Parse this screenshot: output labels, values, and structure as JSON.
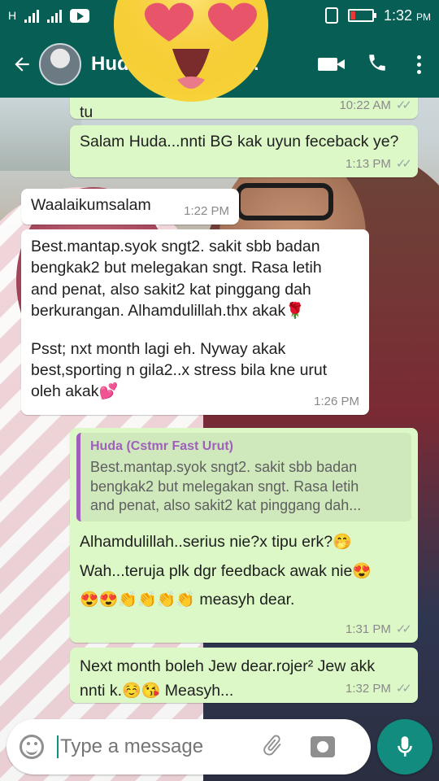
{
  "status_bar": {
    "carrier1": "H",
    "time": "1:32",
    "time_suffix": "PM"
  },
  "header": {
    "contact_name": "Hud",
    "contact_name_tail": "..."
  },
  "messages": [
    {
      "dir": "out",
      "text": "tu",
      "time": "10:22 AM"
    },
    {
      "dir": "out",
      "text": "Salam Huda...nnti BG kak uyun feceback ye?",
      "time": "1:13 PM"
    },
    {
      "dir": "in",
      "text": "Waalaikumsalam",
      "time": "1:22 PM"
    },
    {
      "dir": "in",
      "text_lines": [
        "Best.mantap.syok sngt2. sakit sbb badan",
        "bengkak2 but melegakan sngt. Rasa letih",
        "and penat, also sakit2 kat pinggang dah",
        "berkurangan. Alhamdulillah.thx akak"
      ],
      "emoji1": "🌹",
      "text2_lines": [
        "Psst; nxt month lagi eh. Nyway akak",
        "best,sporting n gila2..x stress bila kne urut",
        "oleh akak"
      ],
      "emoji2": "💕",
      "time": "1:26 PM"
    },
    {
      "dir": "out",
      "quote_name": "Huda (Cstmr Fast Urut)",
      "quote_lines": [
        "Best.mantap.syok sngt2. sakit sbb badan",
        "bengkak2 but melegakan sngt. Rasa letih",
        "and penat, also sakit2 kat pinggang dah..."
      ],
      "line1": "Alhamdulillah..serius nie?x tipu erk?",
      "line1_emoji": "🤭",
      "line2": "Wah...teruja plk dgr feedback awak nie",
      "line2_emoji": "😍",
      "line3_emoji": "😍😍👏👏👏👏",
      "line3": " measyh dear.",
      "time": "1:31 PM"
    },
    {
      "dir": "out",
      "line1": "Next month boleh Jew dear.rojer² Jew akk",
      "line2a": "nnti k.",
      "line2_emoji": "☺️😘",
      "line2b": " Measyh...",
      "time": "1:32 PM"
    }
  ],
  "input": {
    "placeholder": "Type a message"
  },
  "icons": {
    "back": "arrow-back-icon",
    "video": "video-call-icon",
    "phone": "phone-icon",
    "more": "more-vert-icon",
    "emoji": "smiley-icon",
    "attach": "attach-icon",
    "camera": "camera-icon",
    "mic": "mic-icon"
  },
  "colors": {
    "header": "#075e54",
    "outgoing_bubble": "#dcf8c6",
    "incoming_bubble": "#ffffff",
    "accent": "#128c7e",
    "quote_bar": "#a05fbc"
  }
}
